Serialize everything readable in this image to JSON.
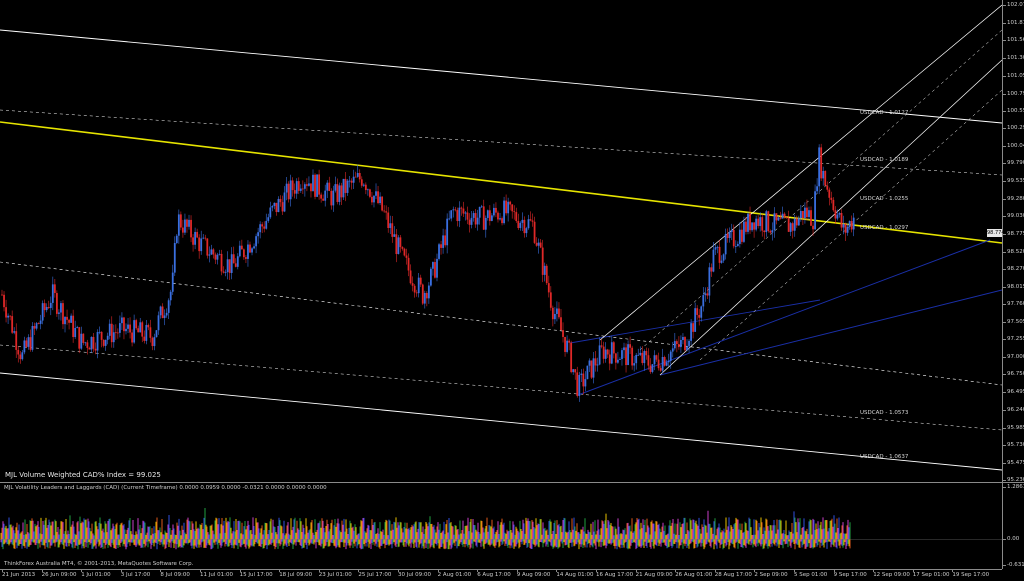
{
  "window": {
    "index_label": "MJL Volume Weighted CAD% Index = 99.025",
    "indicator_title": "MJL Volatility Leaders and Laggards (CAD) (Current Timeframe) 0.0000 0.0959 0.0000 -0.0321 0.0000 0.0000 0.0000",
    "footer": "ThinkForex Australia MT4, © 2001-2013, MetaQuotes Software Corp.",
    "current_price_tag": "98.774"
  },
  "channel_labels": [
    {
      "text": "USDCAD - 1.0127"
    },
    {
      "text": "USDCAD - 1.0189"
    },
    {
      "text": "USDCAD - 1.0255"
    },
    {
      "text": "USDCAD - 1.0297"
    },
    {
      "text": "USDCAD - 1.0573"
    },
    {
      "text": "USDCAD - 1.0637"
    }
  ],
  "colors": {
    "background": "#000000",
    "bull_candle": "#3a6fe0",
    "bear_candle": "#e02828",
    "yellow_line": "#e6e400",
    "channel_white": "#ffffff",
    "channel_blue": "#1a2fa8",
    "histogram": [
      "#e6c000",
      "#e05a1a",
      "#c83ec8",
      "#3050e0",
      "#20a040"
    ]
  },
  "chart_data": [
    {
      "type": "candlestick",
      "title": "MJL Volume Weighted CAD% Index = 99.025",
      "ylim": [
        95.23,
        102.07
      ],
      "y_ticks": [
        "102.070",
        "101.815",
        "101.560",
        "101.305",
        "101.050",
        "100.795",
        "100.550",
        "100.295",
        "100.040",
        "99.790",
        "99.535",
        "99.280",
        "99.030",
        "98.775",
        "98.520",
        "98.270",
        "98.015",
        "97.760",
        "97.505",
        "97.255",
        "97.000",
        "96.750",
        "96.495",
        "96.240",
        "95.985",
        "95.730",
        "95.475",
        "95.230"
      ],
      "x_ticks": [
        "21 Jun 2013",
        "26 Jun 09:00",
        "1 Jul 01:00",
        "3 Jul 17:00",
        "8 Jul 09:00",
        "11 Jul 01:00",
        "15 Jul 17:00",
        "18 Jul 09:00",
        "23 Jul 01:00",
        "25 Jul 17:00",
        "30 Jul 09:00",
        "2 Aug 01:00",
        "6 Aug 17:00",
        "9 Aug 09:00",
        "14 Aug 01:00",
        "16 Aug 17:00",
        "21 Aug 09:00",
        "26 Aug 01:00",
        "28 Aug 17:00",
        "2 Sep 09:00",
        "5 Sep 01:00",
        "9 Sep 17:00",
        "12 Sep 09:00",
        "17 Sep 01:00",
        "19 Sep 17:00"
      ],
      "close_path": [
        [
          0,
          97.9
        ],
        [
          0.02,
          97.0
        ],
        [
          0.05,
          97.9
        ],
        [
          0.08,
          97.2
        ],
        [
          0.12,
          97.4
        ],
        [
          0.15,
          97.3
        ],
        [
          0.17,
          98.0
        ],
        [
          0.175,
          99.0
        ],
        [
          0.2,
          98.6
        ],
        [
          0.23,
          98.3
        ],
        [
          0.27,
          99.1
        ],
        [
          0.3,
          99.6
        ],
        [
          0.33,
          99.3
        ],
        [
          0.36,
          99.6
        ],
        [
          0.38,
          99.1
        ],
        [
          0.4,
          98.4
        ],
        [
          0.42,
          97.9
        ],
        [
          0.43,
          98.2
        ],
        [
          0.45,
          99.1
        ],
        [
          0.48,
          99.0
        ],
        [
          0.5,
          99.1
        ],
        [
          0.53,
          98.9
        ],
        [
          0.55,
          97.7
        ],
        [
          0.565,
          97.1
        ],
        [
          0.575,
          96.55
        ],
        [
          0.6,
          97.1
        ],
        [
          0.63,
          97.0
        ],
        [
          0.65,
          96.9
        ],
        [
          0.68,
          97.2
        ],
        [
          0.7,
          97.8
        ],
        [
          0.71,
          98.45
        ],
        [
          0.73,
          98.7
        ],
        [
          0.75,
          99.0
        ],
        [
          0.77,
          98.9
        ],
        [
          0.79,
          98.9
        ],
        [
          0.8,
          99.1
        ],
        [
          0.81,
          99.0
        ],
        [
          0.815,
          99.9
        ],
        [
          0.82,
          99.6
        ],
        [
          0.83,
          99.2
        ],
        [
          0.84,
          98.8
        ],
        [
          0.85,
          99.0
        ]
      ]
    },
    {
      "type": "bar",
      "title": "MJL Volatility Leaders and Laggards (CAD) (Current Timeframe) 0.0000 0.0959 0.0000 -0.0321 0.0000 0.0000 0.0000",
      "ylim": [
        -0.6312,
        1.2861
      ],
      "y_ticks": [
        "1.2861",
        "0.00",
        "-0.6312"
      ],
      "series_names": []
    }
  ]
}
